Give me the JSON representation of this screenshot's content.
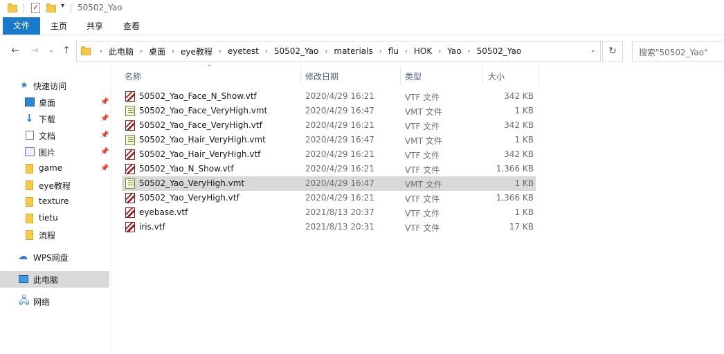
{
  "window": {
    "title": "50502_Yao"
  },
  "ribbon": {
    "tabs": [
      "文件",
      "主页",
      "共享",
      "查看"
    ]
  },
  "address": {
    "breadcrumbs": [
      "此电脑",
      "桌面",
      "eye教程",
      "eyetest",
      "50502_Yao",
      "materials",
      "flu",
      "HOK",
      "Yao",
      "50502_Yao"
    ]
  },
  "search": {
    "placeholder": "搜索\"50502_Yao\""
  },
  "nav": {
    "quick_access": "快速访问",
    "items": [
      {
        "label": "桌面",
        "icon": "desktop-icon",
        "pinned": true
      },
      {
        "label": "下载",
        "icon": "download-icon",
        "pinned": true
      },
      {
        "label": "文档",
        "icon": "document-icon",
        "pinned": true
      },
      {
        "label": "图片",
        "icon": "pictures-icon",
        "pinned": true
      },
      {
        "label": "game",
        "icon": "folder-icon",
        "pinned": true
      },
      {
        "label": "eye教程",
        "icon": "folder-icon",
        "pinned": false
      },
      {
        "label": "texture",
        "icon": "folder-icon",
        "pinned": false
      },
      {
        "label": "tietu",
        "icon": "folder-icon",
        "pinned": false
      },
      {
        "label": "流程",
        "icon": "folder-icon",
        "pinned": false
      }
    ],
    "wps": "WPS网盘",
    "this_pc": "此电脑",
    "network": "网络"
  },
  "columns": {
    "name": "名称",
    "date": "修改日期",
    "type": "类型",
    "size": "大小"
  },
  "files": [
    {
      "name": "50502_Yao_Face_N_Show.vtf",
      "date": "2020/4/29 16:21",
      "type": "VTF 文件",
      "size": "342 KB",
      "kind": "vtf"
    },
    {
      "name": "50502_Yao_Face_VeryHigh.vmt",
      "date": "2020/4/29 16:47",
      "type": "VMT 文件",
      "size": "1 KB",
      "kind": "vmt"
    },
    {
      "name": "50502_Yao_Face_VeryHigh.vtf",
      "date": "2020/4/29 16:21",
      "type": "VTF 文件",
      "size": "342 KB",
      "kind": "vtf"
    },
    {
      "name": "50502_Yao_Hair_VeryHigh.vmt",
      "date": "2020/4/29 16:47",
      "type": "VMT 文件",
      "size": "1 KB",
      "kind": "vmt"
    },
    {
      "name": "50502_Yao_Hair_VeryHigh.vtf",
      "date": "2020/4/29 16:21",
      "type": "VTF 文件",
      "size": "342 KB",
      "kind": "vtf"
    },
    {
      "name": "50502_Yao_N_Show.vtf",
      "date": "2020/4/29 16:21",
      "type": "VTF 文件",
      "size": "1,366 KB",
      "kind": "vtf"
    },
    {
      "name": "50502_Yao_VeryHigh.vmt",
      "date": "2020/4/29 16:47",
      "type": "VMT 文件",
      "size": "1 KB",
      "kind": "vmt",
      "selected": true
    },
    {
      "name": "50502_Yao_VeryHigh.vtf",
      "date": "2020/4/29 16:21",
      "type": "VTF 文件",
      "size": "1,366 KB",
      "kind": "vtf"
    },
    {
      "name": "eyebase.vtf",
      "date": "2021/8/13 20:37",
      "type": "VTF 文件",
      "size": "1 KB",
      "kind": "vtf"
    },
    {
      "name": "iris.vtf",
      "date": "2021/8/13 20:31",
      "type": "VTF 文件",
      "size": "17 KB",
      "kind": "vtf"
    }
  ]
}
